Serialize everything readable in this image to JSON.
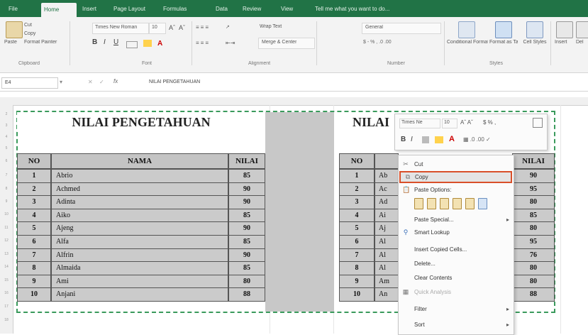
{
  "tabs": [
    "File",
    "Home",
    "Insert",
    "Page Layout",
    "Formulas",
    "Data",
    "Review",
    "View",
    "Tell me what you want to do..."
  ],
  "ribbon": {
    "clipboard": {
      "paste": "Paste",
      "cut": "Cut",
      "copy": "Copy",
      "format_painter": "Format Painter",
      "group": "Clipboard"
    },
    "font": {
      "name": "Times New Roman",
      "size": "10",
      "group": "Font"
    },
    "alignment": {
      "wrap_text": "Wrap Text",
      "merge_center": "Merge & Center",
      "group": "Alignment"
    },
    "number": {
      "format": "General",
      "group": "Number"
    },
    "styles": {
      "conditional": "Conditional Formatting",
      "format_table": "Format as Table",
      "cell_styles": "Cell Styles",
      "group": "Styles"
    },
    "cells": {
      "insert": "Insert",
      "delete": "Del"
    }
  },
  "formula_bar": {
    "name_box": "E4",
    "content": "NILAI PENGETAHUAN"
  },
  "left_table": {
    "title": "NILAI PENGETAHUAN",
    "headers": [
      "NO",
      "NAMA",
      "NILAI"
    ],
    "rows": [
      [
        "1",
        "Abrio",
        "85"
      ],
      [
        "2",
        "Achmed",
        "90"
      ],
      [
        "3",
        "Adinta",
        "90"
      ],
      [
        "4",
        "Aiko",
        "85"
      ],
      [
        "5",
        "Ajeng",
        "90"
      ],
      [
        "6",
        "Alfa",
        "85"
      ],
      [
        "7",
        "Alfrin",
        "90"
      ],
      [
        "8",
        "Almaida",
        "85"
      ],
      [
        "9",
        "Ami",
        "80"
      ],
      [
        "10",
        "Anjani",
        "88"
      ]
    ]
  },
  "right_table": {
    "title": "NILAI",
    "headers": [
      "NO",
      "",
      "NILAI"
    ],
    "rows": [
      [
        "1",
        "Ab",
        "90"
      ],
      [
        "2",
        "Ac",
        "95"
      ],
      [
        "3",
        "Ad",
        "80"
      ],
      [
        "4",
        "Ai",
        "85"
      ],
      [
        "5",
        "Aj",
        "80"
      ],
      [
        "6",
        "Al",
        "95"
      ],
      [
        "7",
        "Al",
        "76"
      ],
      [
        "8",
        "Al",
        "80"
      ],
      [
        "9",
        "Am",
        "80"
      ],
      [
        "10",
        "An",
        "88"
      ]
    ]
  },
  "mini_toolbar": {
    "font": "Times Ne",
    "size": "10"
  },
  "context_menu": {
    "items": [
      "Cut",
      "Copy",
      "Paste Options:",
      "",
      "Paste Special...",
      "Smart Lookup",
      "Insert Copied Cells...",
      "Delete...",
      "Clear Contents",
      "Quick Analysis",
      "Filter",
      "Sort"
    ],
    "highlighted": "Copy"
  },
  "colors": {
    "brand": "#217346",
    "highlight_border": "#d9502a"
  }
}
